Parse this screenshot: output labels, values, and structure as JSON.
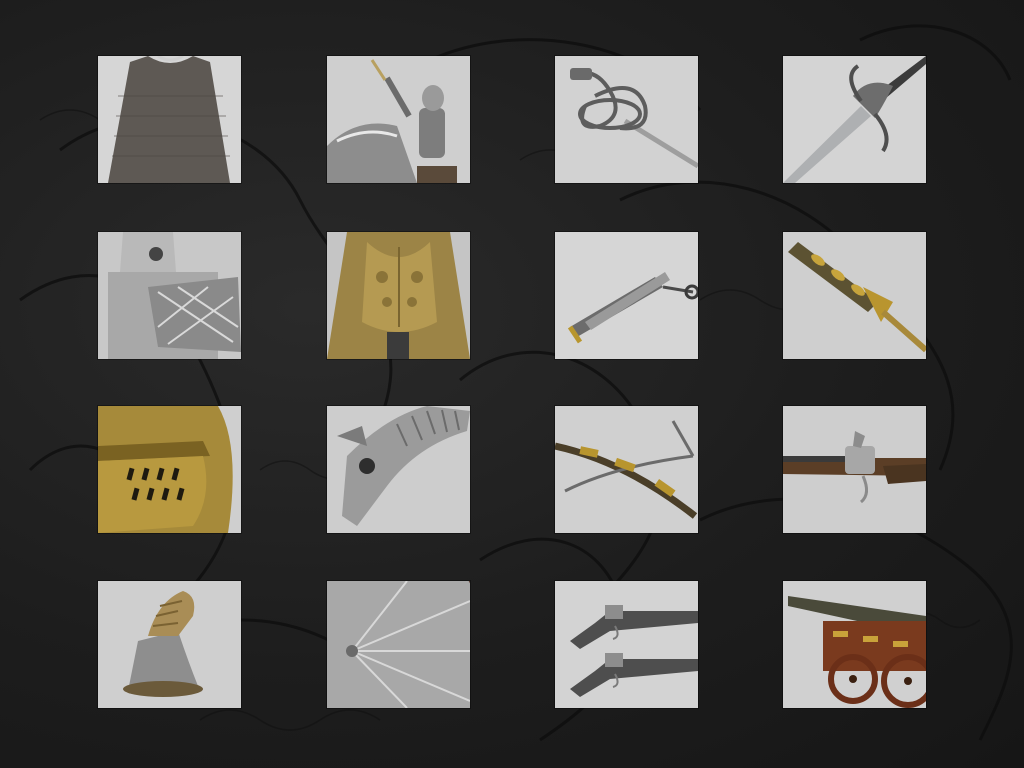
{
  "page": {
    "background_color": "#1e1e1e",
    "engraving_color": "#0e0e0e"
  },
  "gallery": {
    "items": [
      {
        "subject": "chain-mail-shirt",
        "icon": "mail-shirt-icon"
      },
      {
        "subject": "armored-knight-on-horse",
        "icon": "knight-icon"
      },
      {
        "subject": "swept-hilt-rapier",
        "icon": "rapier-icon"
      },
      {
        "subject": "parrying-dagger",
        "icon": "dagger-icon"
      },
      {
        "subject": "jousting-armor",
        "icon": "jousting-armor-icon"
      },
      {
        "subject": "gilded-breastplate",
        "icon": "breastplate-icon"
      },
      {
        "subject": "sheathed-knife",
        "icon": "sheath-icon"
      },
      {
        "subject": "gilded-dagger",
        "icon": "gilded-dagger-icon"
      },
      {
        "subject": "gilded-close-helmet",
        "icon": "helmet-icon"
      },
      {
        "subject": "horse-chanfron",
        "icon": "chanfron-icon"
      },
      {
        "subject": "crossbow",
        "icon": "crossbow-icon"
      },
      {
        "subject": "flintlock-gun",
        "icon": "flintlock-icon"
      },
      {
        "subject": "gauntlet",
        "icon": "gauntlet-icon"
      },
      {
        "subject": "etched-shield",
        "icon": "shield-icon"
      },
      {
        "subject": "pair-of-pistols",
        "icon": "pistols-icon"
      },
      {
        "subject": "model-cannon",
        "icon": "cannon-icon"
      }
    ]
  }
}
